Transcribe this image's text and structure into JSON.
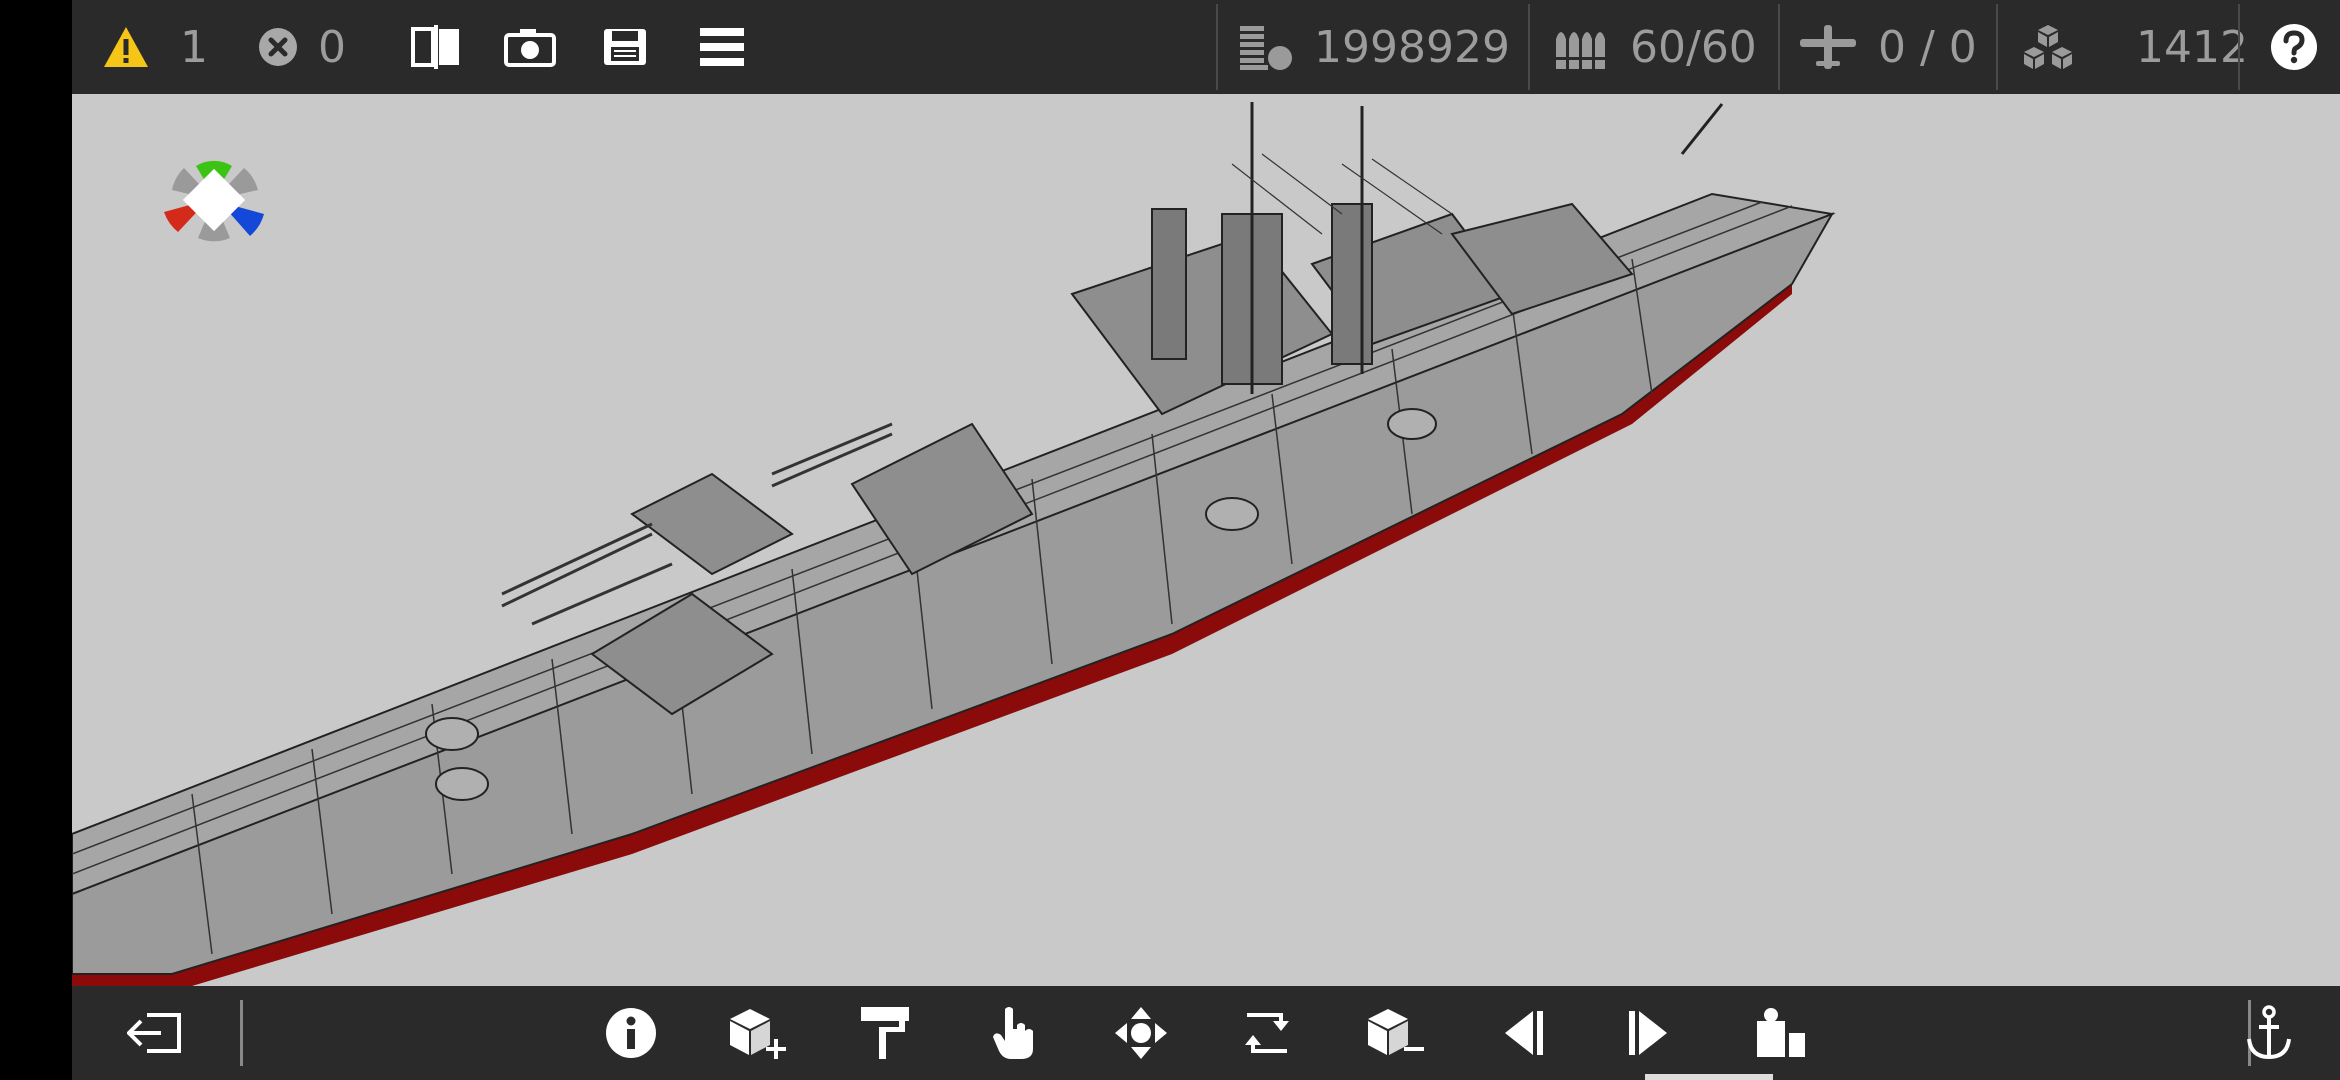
{
  "topbar": {
    "warnings": {
      "icon": "warning-icon",
      "count": "1",
      "color": "#f5c518"
    },
    "errors": {
      "icon": "error-icon",
      "count": "0"
    },
    "tools": [
      "mirror-icon",
      "camera-icon",
      "save-icon",
      "menu-icon"
    ],
    "stats": [
      {
        "icon": "weight-icon",
        "value": "1998929"
      },
      {
        "icon": "ammo-icon",
        "value": "60/60"
      },
      {
        "icon": "aircraft-icon",
        "value": "0 / 0"
      },
      {
        "icon": "blocks-icon",
        "value": "1412"
      }
    ],
    "help_icon": "help-icon"
  },
  "bottombar": {
    "exit_icon": "exit-icon",
    "tools": [
      "info-icon",
      "add-block-icon",
      "paint-icon",
      "select-hand-icon",
      "move-icon",
      "rotate-icon",
      "remove-block-icon",
      "previous-icon",
      "next-icon",
      "ship-builder-icon"
    ],
    "anchor_icon": "anchor-icon",
    "active_tool": "ship-builder-icon"
  },
  "gizmo": {
    "axis_colors": {
      "x": "#d42a1a",
      "y": "#3cc414",
      "z": "#1448d8",
      "neutral": "#9a9a9a"
    }
  },
  "ship": {
    "hull_color": "#8a8a8a",
    "waterline_color": "#8b0a0a",
    "background_color": "#c9c9c9"
  }
}
